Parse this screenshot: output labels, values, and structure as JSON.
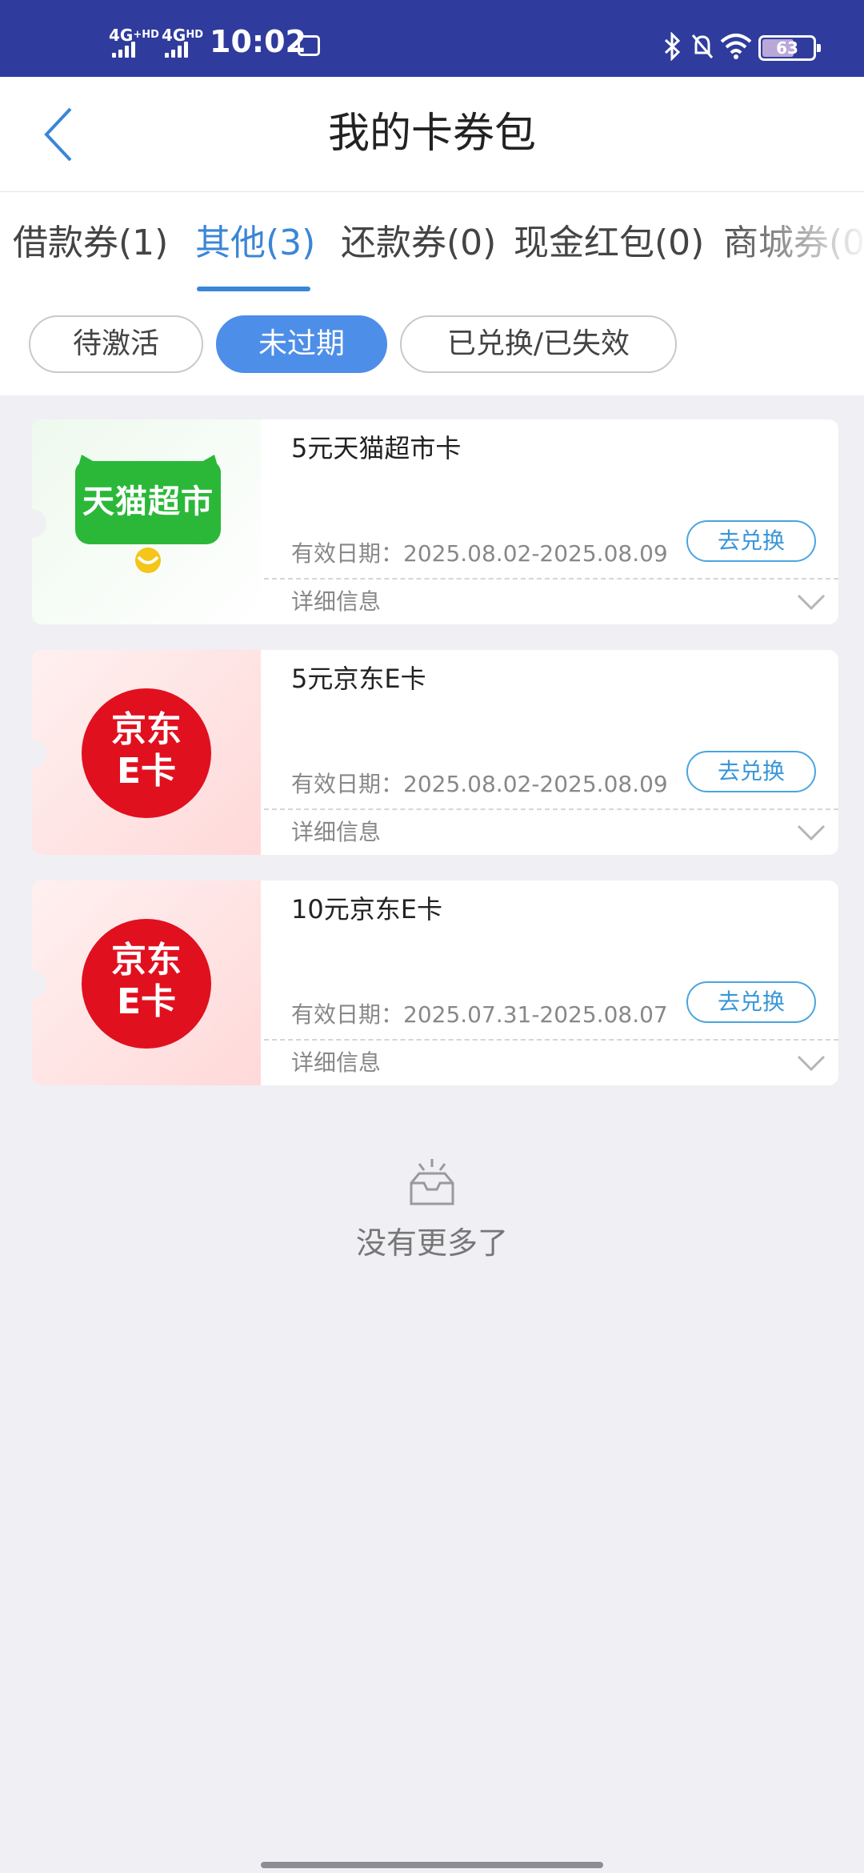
{
  "status_bar": {
    "net1": "4G",
    "net1_sup": "+HD",
    "net2": "4G",
    "net2_sup": "HD",
    "time": "10:02",
    "battery": "63",
    "battery_level": 0.63,
    "icons": [
      "sim-card-icon",
      "bluetooth-icon",
      "mute-bell-icon",
      "wifi-icon",
      "battery-icon"
    ]
  },
  "header": {
    "title": "我的卡券包",
    "back_icon": "chevron-left-icon"
  },
  "tabs": [
    {
      "label": "借款券(1)",
      "active": false
    },
    {
      "label": "其他(3)",
      "active": true
    },
    {
      "label": "还款券(0)",
      "active": false
    },
    {
      "label": "现金红包(0)",
      "active": false
    },
    {
      "label": "商城券(0",
      "active": false
    }
  ],
  "filters": [
    {
      "label": "待激活",
      "active": false
    },
    {
      "label": "未过期",
      "active": true
    },
    {
      "label": "已兑换/已失效",
      "active": false
    }
  ],
  "cards": [
    {
      "name": "5元天猫超市卡",
      "date": "有效日期：2025.08.02-2025.08.09",
      "button": "去兑换",
      "details": "详细信息",
      "logo": "天猫超市",
      "logo_color": "#2bb839"
    },
    {
      "name": "5元京东E卡",
      "date": "有效日期：2025.08.02-2025.08.09",
      "button": "去兑换",
      "details": "详细信息",
      "logo_line1": "京东",
      "logo_line2": "E卡",
      "logo_color": "#e0101f"
    },
    {
      "name": "10元京东E卡",
      "date": "有效日期：2025.07.31-2025.08.07",
      "button": "去兑换",
      "details": "详细信息",
      "logo_line1": "京东",
      "logo_line2": "E卡",
      "logo_color": "#e0101f"
    }
  ],
  "empty": {
    "text": "没有更多了",
    "icon": "empty-tray-icon"
  },
  "colors": {
    "status_bar": "#2f3c9d",
    "accent": "#3a86d6",
    "chip_active": "#4d8ee8",
    "background": "#efeff4"
  }
}
